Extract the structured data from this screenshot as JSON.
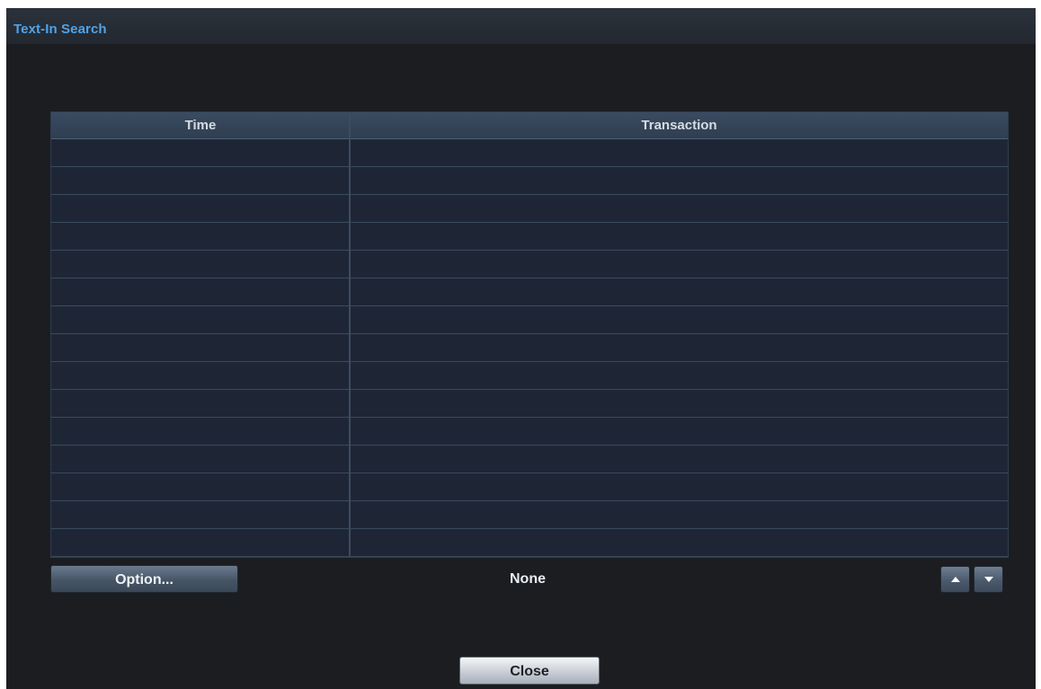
{
  "window": {
    "title": "Text-In Search"
  },
  "table": {
    "columns": [
      "Time",
      "Transaction"
    ],
    "rows": [
      {
        "time": "",
        "transaction": ""
      },
      {
        "time": "",
        "transaction": ""
      },
      {
        "time": "",
        "transaction": ""
      },
      {
        "time": "",
        "transaction": ""
      },
      {
        "time": "",
        "transaction": ""
      },
      {
        "time": "",
        "transaction": ""
      },
      {
        "time": "",
        "transaction": ""
      },
      {
        "time": "",
        "transaction": ""
      },
      {
        "time": "",
        "transaction": ""
      },
      {
        "time": "",
        "transaction": ""
      },
      {
        "time": "",
        "transaction": ""
      },
      {
        "time": "",
        "transaction": ""
      },
      {
        "time": "",
        "transaction": ""
      },
      {
        "time": "",
        "transaction": ""
      },
      {
        "time": "",
        "transaction": ""
      }
    ]
  },
  "controls": {
    "option_label": "Option...",
    "status_text": "None",
    "up_icon": "triangle-up-icon",
    "down_icon": "triangle-down-icon",
    "close_label": "Close"
  },
  "colors": {
    "title_accent": "#4fa3e8",
    "background": "#1b1d21",
    "grid_background": "#1e2636"
  }
}
